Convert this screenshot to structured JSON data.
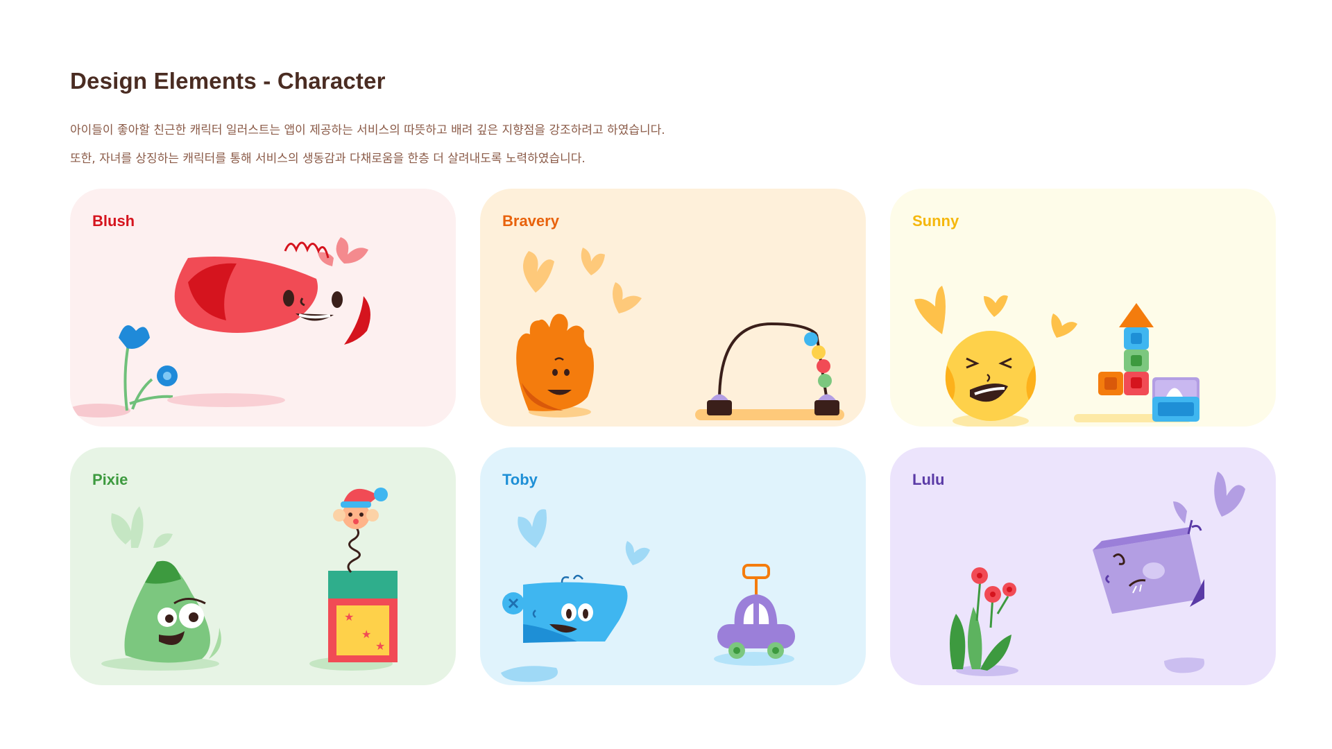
{
  "page": {
    "title": "Design Elements - Character",
    "description_line1": "아이들이 좋아할 친근한 캐릭터 일러스트는 앱이 제공하는 서비스의 따뜻하고 배려 깊은 지향점을 강조하려고 하였습니다.",
    "description_line2": "또한, 자녀를 상징하는 캐릭터를 통해 서비스의 생동감과 다채로움을 한층 더 살려내도록 노력하였습니다."
  },
  "cards": [
    {
      "name": "Blush",
      "bg": "#fdf0f0",
      "name_color": "#d5141e",
      "icons": [
        "blush-character-icon",
        "blue-flower-icon",
        "heart-icon"
      ]
    },
    {
      "name": "Bravery",
      "bg": "#fef0da",
      "name_color": "#e8620c",
      "icons": [
        "bravery-character-icon",
        "bead-maze-toy-icon",
        "heart-icon"
      ]
    },
    {
      "name": "Sunny",
      "bg": "#fefce9",
      "name_color": "#f5b70d",
      "icons": [
        "sunny-character-icon",
        "toy-blocks-icon",
        "heart-icon"
      ]
    },
    {
      "name": "Pixie",
      "bg": "#e7f4e5",
      "name_color": "#3d9a3f",
      "icons": [
        "pixie-character-icon",
        "jack-in-the-box-icon",
        "leaf-icon"
      ]
    },
    {
      "name": "Toby",
      "bg": "#e0f3fc",
      "name_color": "#1e8fd6",
      "icons": [
        "toby-character-icon",
        "toy-car-icon",
        "heart-icon"
      ]
    },
    {
      "name": "Lulu",
      "bg": "#ece4fc",
      "name_color": "#5a3aa6",
      "icons": [
        "lulu-character-icon",
        "red-flowers-icon",
        "heart-icon"
      ]
    }
  ]
}
